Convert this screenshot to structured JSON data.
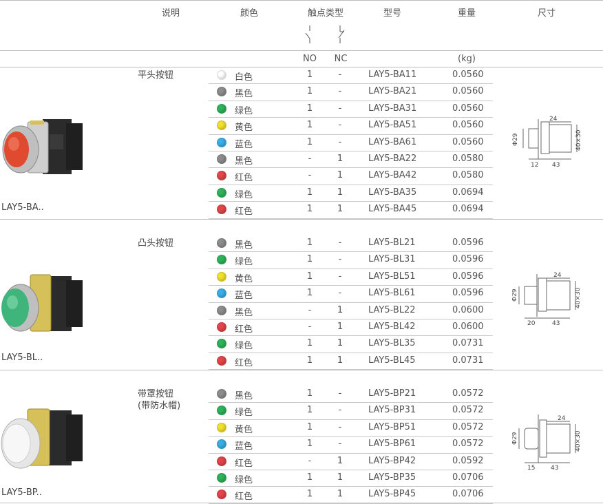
{
  "header": {
    "desc": "说明",
    "color": "颜色",
    "contact": "触点类型",
    "model": "型号",
    "weight": "重量",
    "size": "尺寸"
  },
  "subheader": {
    "no": "NO",
    "nc": "NC",
    "unit": "(kg)"
  },
  "groups": [
    {
      "name": "平头按钮",
      "model_label": "LAY5-BA..",
      "button_color": "#e04a2f",
      "dims": {
        "d": "Φ29",
        "w": "24",
        "h": "40×30",
        "a": "12",
        "b": "43"
      },
      "rows": [
        {
          "color": "#ffffff",
          "label": "白色",
          "no": "1",
          "nc": "-",
          "model": "LAY5-BA11",
          "weight": "0.0560"
        },
        {
          "color": "#8d8d8d",
          "label": "黑色",
          "no": "1",
          "nc": "-",
          "model": "LAY5-BA21",
          "weight": "0.0560"
        },
        {
          "color": "#2fb35a",
          "label": "绿色",
          "no": "1",
          "nc": "-",
          "model": "LAY5-BA31",
          "weight": "0.0560"
        },
        {
          "color": "#f2e12a",
          "label": "黄色",
          "no": "1",
          "nc": "-",
          "model": "LAY5-BA51",
          "weight": "0.0560"
        },
        {
          "color": "#3aaee6",
          "label": "蓝色",
          "no": "1",
          "nc": "-",
          "model": "LAY5-BA61",
          "weight": "0.0560"
        },
        {
          "color": "#8d8d8d",
          "label": "黑色",
          "no": "-",
          "nc": "1",
          "model": "LAY5-BA22",
          "weight": "0.0580"
        },
        {
          "color": "#e4454a",
          "label": "红色",
          "no": "-",
          "nc": "1",
          "model": "LAY5-BA42",
          "weight": "0.0580"
        },
        {
          "color": "#2fb35a",
          "label": "绿色",
          "no": "1",
          "nc": "1",
          "model": "LAY5-BA35",
          "weight": "0.0694"
        },
        {
          "color": "#e4454a",
          "label": "红色",
          "no": "1",
          "nc": "1",
          "model": "LAY5-BA45",
          "weight": "0.0694"
        }
      ]
    },
    {
      "name": "凸头按钮",
      "model_label": "LAY5-BL..",
      "button_color": "#3fb57c",
      "dims": {
        "d": "Φ29",
        "w": "24",
        "h": "40×30",
        "a": "20",
        "b": "43"
      },
      "rows": [
        {
          "color": "#8d8d8d",
          "label": "黑色",
          "no": "1",
          "nc": "-",
          "model": "LAY5-BL21",
          "weight": "0.0596"
        },
        {
          "color": "#2fb35a",
          "label": "绿色",
          "no": "1",
          "nc": "-",
          "model": "LAY5-BL31",
          "weight": "0.0596"
        },
        {
          "color": "#f2e12a",
          "label": "黄色",
          "no": "1",
          "nc": "-",
          "model": "LAY5-BL51",
          "weight": "0.0596"
        },
        {
          "color": "#3aaee6",
          "label": "蓝色",
          "no": "1",
          "nc": "-",
          "model": "LAY5-BL61",
          "weight": "0.0596"
        },
        {
          "color": "#8d8d8d",
          "label": "黑色",
          "no": "-",
          "nc": "1",
          "model": "LAY5-BL22",
          "weight": "0.0600"
        },
        {
          "color": "#e4454a",
          "label": "红色",
          "no": "-",
          "nc": "1",
          "model": "LAY5-BL42",
          "weight": "0.0600"
        },
        {
          "color": "#2fb35a",
          "label": "绿色",
          "no": "1",
          "nc": "1",
          "model": "LAY5-BL35",
          "weight": "0.0731"
        },
        {
          "color": "#e4454a",
          "label": "红色",
          "no": "1",
          "nc": "1",
          "model": "LAY5-BL45",
          "weight": "0.0731"
        }
      ]
    },
    {
      "name": "带罩按钮",
      "name2": "(带防水帽)",
      "model_label": "LAY5-BP..",
      "button_color": "#f2f2f2",
      "dims": {
        "d": "Φ29",
        "w": "24",
        "h": "40×30",
        "a": "15",
        "b": "43"
      },
      "rows": [
        {
          "color": "#8d8d8d",
          "label": "黑色",
          "no": "1",
          "nc": "-",
          "model": "LAY5-BP21",
          "weight": "0.0572"
        },
        {
          "color": "#2fb35a",
          "label": "绿色",
          "no": "1",
          "nc": "-",
          "model": "LAY5-BP31",
          "weight": "0.0572"
        },
        {
          "color": "#f2e12a",
          "label": "黄色",
          "no": "1",
          "nc": "-",
          "model": "LAY5-BP51",
          "weight": "0.0572"
        },
        {
          "color": "#3aaee6",
          "label": "蓝色",
          "no": "1",
          "nc": "-",
          "model": "LAY5-BP61",
          "weight": "0.0572"
        },
        {
          "color": "#e4454a",
          "label": "红色",
          "no": "-",
          "nc": "1",
          "model": "LAY5-BP42",
          "weight": "0.0592"
        },
        {
          "color": "#2fb35a",
          "label": "绿色",
          "no": "1",
          "nc": "1",
          "model": "LAY5-BP35",
          "weight": "0.0706"
        },
        {
          "color": "#e4454a",
          "label": "红色",
          "no": "1",
          "nc": "1",
          "model": "LAY5-BP45",
          "weight": "0.0706"
        }
      ]
    }
  ]
}
